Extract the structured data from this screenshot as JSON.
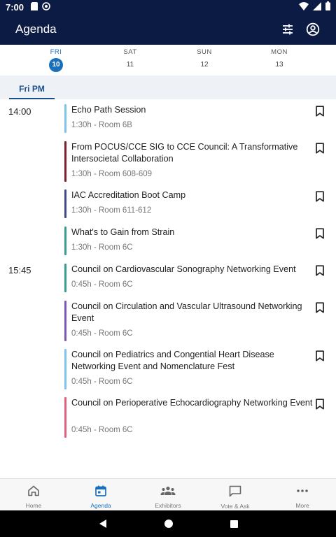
{
  "status": {
    "time": "7:00"
  },
  "appbar": {
    "title": "Agenda",
    "filter_icon": "filter-sliders-icon",
    "profile_icon": "account-circle-icon"
  },
  "days": [
    {
      "name": "FRI",
      "date": "10",
      "active": true
    },
    {
      "name": "SAT",
      "date": "11",
      "active": false
    },
    {
      "name": "SUN",
      "date": "12",
      "active": false
    },
    {
      "name": "MON",
      "date": "13",
      "active": false
    }
  ],
  "tab": {
    "label": "Fri PM"
  },
  "time_groups": [
    {
      "time": "14:00"
    },
    {
      "time": "15:45"
    }
  ],
  "sessions": [
    {
      "title": "Echo Path Session",
      "meta": "1:30h - Room 6B",
      "color": "#7fc3e8"
    },
    {
      "title": "From POCUS/CCE SIG to CCE Council: A Transformative Intersocietal Collaboration",
      "meta": "1:30h - Room 608-609",
      "color": "#7a1f2b"
    },
    {
      "title": "IAC Accreditation Boot Camp",
      "meta": "1:30h - Room 611-612",
      "color": "#3f4a8c"
    },
    {
      "title": "What's to Gain from Strain",
      "meta": "1:30h - Room 6C",
      "color": "#3a9c8f"
    },
    {
      "title": "Council on Cardiovascular Sonography Networking Event",
      "meta": "0:45h - Room 6C",
      "color": "#3a9c8f"
    },
    {
      "title": "Council on Circulation and Vascular Ultrasound Networking Event",
      "meta": "0:45h - Room 6C",
      "color": "#7b58b5"
    },
    {
      "title": "Council on Pediatrics and Congential Heart Disease Networking Event and Nomenclature Fest",
      "meta": "0:45h - Room 6C",
      "color": "#7fc3e8"
    },
    {
      "title": "Council on Perioperative Echocardiography Networking Event",
      "meta": "0:45h - Room 6C",
      "color": "#e0627f"
    }
  ],
  "nav": [
    {
      "label": "Home",
      "icon": "home-icon",
      "active": false
    },
    {
      "label": "Agenda",
      "icon": "calendar-icon",
      "active": true
    },
    {
      "label": "Exhibitors",
      "icon": "people-group-icon",
      "active": false
    },
    {
      "label": "Vote & Ask",
      "icon": "chat-bubble-icon",
      "active": false
    },
    {
      "label": "More",
      "icon": "more-dots-icon",
      "active": false
    }
  ]
}
